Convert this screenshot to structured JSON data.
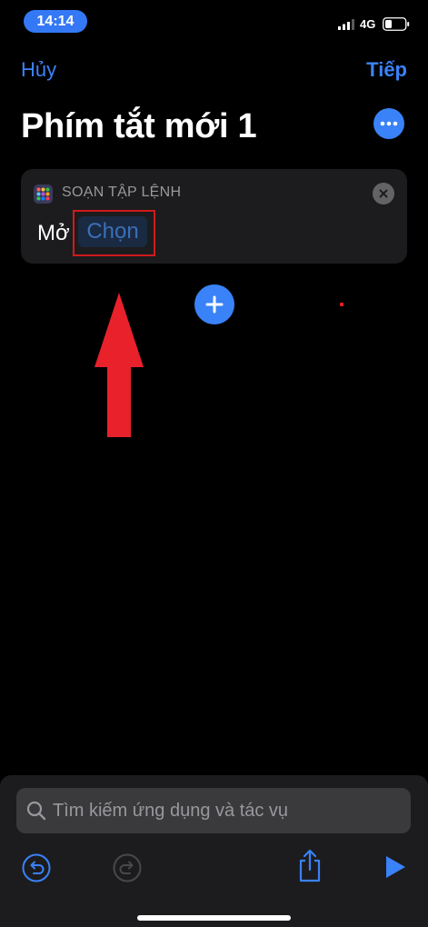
{
  "status_bar": {
    "time": "14:14",
    "network": "4G",
    "icons": [
      "signal-bars-icon",
      "battery-icon"
    ]
  },
  "nav": {
    "cancel_label": "Hủy",
    "next_label": "Tiếp"
  },
  "shortcut": {
    "title": "Phím tắt mới 1",
    "more_icon": "ellipsis-icon"
  },
  "action_card": {
    "header": "SOẠN TẬP LỆNH",
    "app_icon": "scripting-grid-icon",
    "open_label": "Mở",
    "choose_token": "Chọn",
    "close_icon": "close-icon"
  },
  "add_action": {
    "icon": "plus-icon"
  },
  "search": {
    "placeholder": "Tìm kiếm ứng dụng và tác vụ",
    "icon": "search-icon"
  },
  "toolbar": {
    "icons": [
      "undo-icon",
      "redo-icon",
      "share-icon",
      "play-icon"
    ]
  },
  "colors": {
    "accent": "#3a82f7",
    "card_bg": "#1c1c1e",
    "highlight": "#d11a1a",
    "arrow": "#e8212b"
  }
}
